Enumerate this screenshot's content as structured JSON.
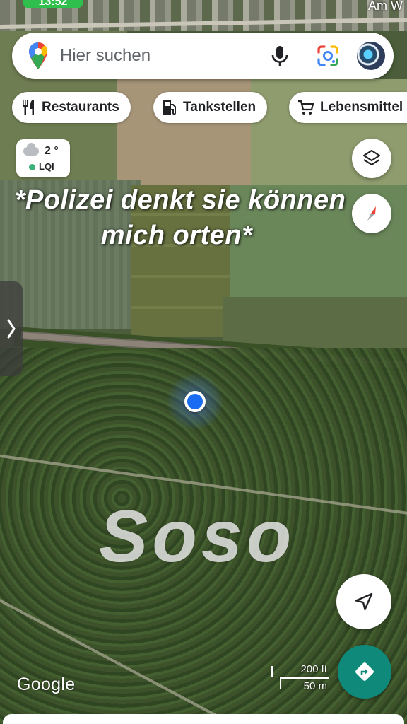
{
  "status": {
    "time": "13:52"
  },
  "map_label_top": "Am W",
  "search": {
    "placeholder": "Hier suchen"
  },
  "chips": [
    {
      "label": "Restaurants",
      "icon": "fork-knife-icon"
    },
    {
      "label": "Tankstellen",
      "icon": "gas-pump-icon"
    },
    {
      "label": "Lebensmittel",
      "icon": "shopping-cart-icon"
    }
  ],
  "weather": {
    "temp": "2 °",
    "aqi_label": "LQI",
    "aqi_color": "#3cb179"
  },
  "caption": {
    "line1": "*Polizei denkt sie können",
    "line2": "mich orten*"
  },
  "watermark": "Soso",
  "map_footer": {
    "logo": "Google",
    "scale_ft": "200 ft",
    "scale_m": "50 m"
  },
  "colors": {
    "directions_button": "#0f8a7a",
    "location_dot": "#1a6cf2"
  }
}
